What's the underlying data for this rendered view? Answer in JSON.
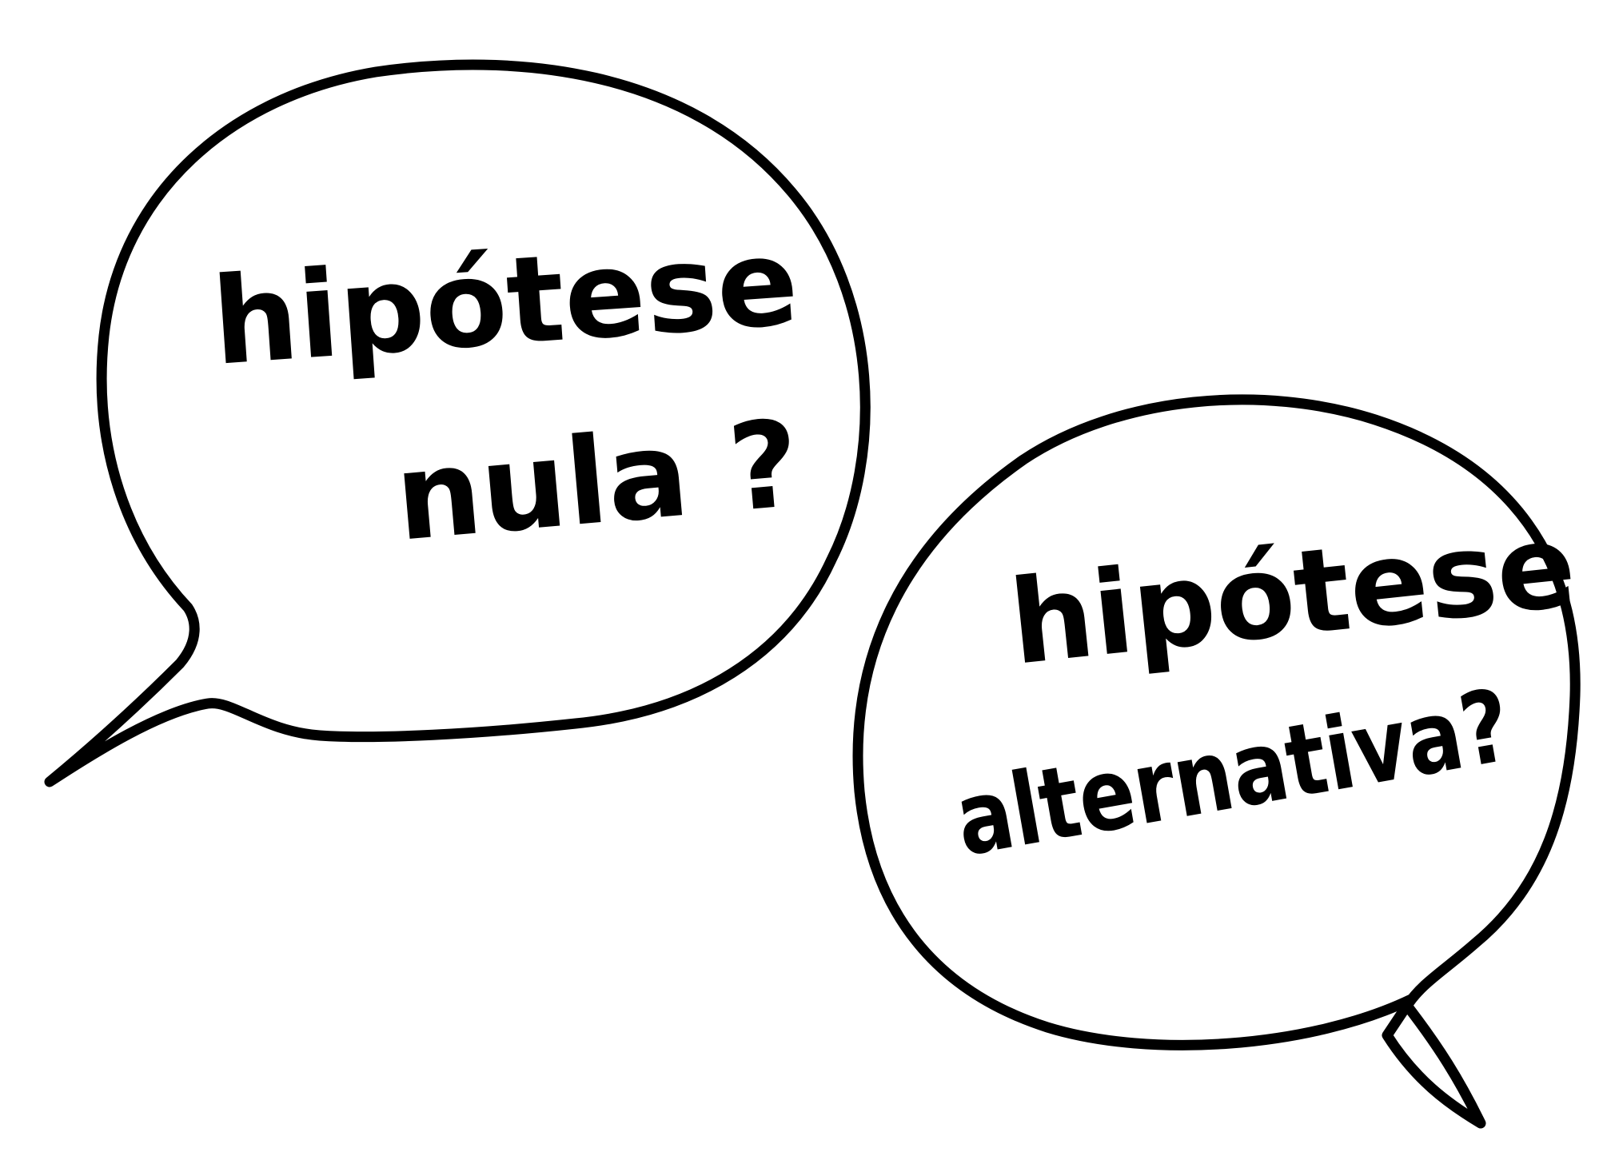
{
  "bubbles": [
    {
      "line1": "hipótese",
      "line2": "nula ?"
    },
    {
      "line1": "hipótese",
      "line2": "alternativa?"
    }
  ],
  "colors": {
    "background": "#ffffff",
    "ink": "#000000"
  }
}
